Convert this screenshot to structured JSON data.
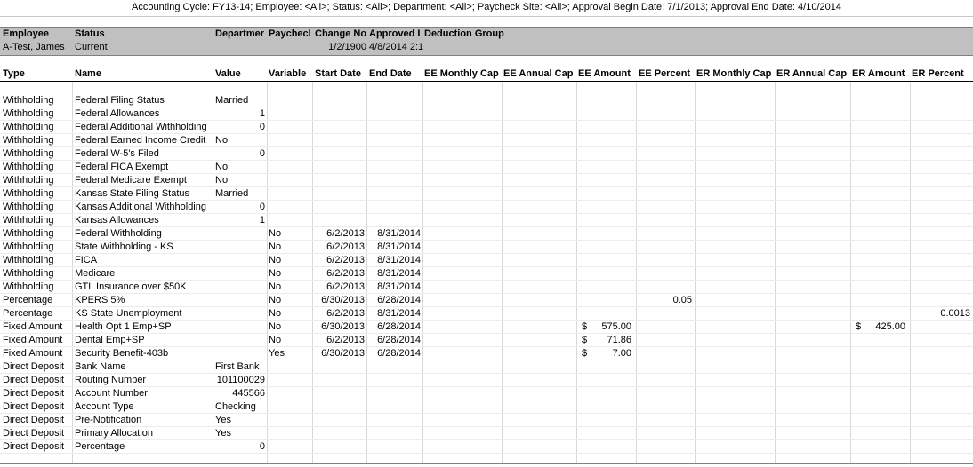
{
  "report": {
    "title": "Accounting Cycle: FY13-14; Employee: <All>; Status: <All>; Department: <All>; Paycheck Site: <All>; Approval Begin Date: 7/1/2013; Approval End Date: 4/10/2014"
  },
  "employee_header": {
    "employee_label": "Employee",
    "status_label": "Status",
    "department_label": "Departmer",
    "paycheck_label": "Paychecl",
    "change_label": "Change No",
    "approved_label": "Approved I",
    "deduction_label": "Deduction Group",
    "employee_name": "A-Test, James",
    "status_value": "Current",
    "change_value": "1/2/1900",
    "approved_value": "4/8/2014 2:1"
  },
  "columns": [
    "Type",
    "Name",
    "Value",
    "Variable",
    "Start Date",
    "End Date",
    "EE Monthly Cap",
    "EE Annual Cap",
    "EE Amount",
    "EE Percent",
    "ER Monthly Cap",
    "ER Annual Cap",
    "ER Amount",
    "ER Percent"
  ],
  "rows": [
    {
      "type": "Withholding",
      "name": "Federal Filing Status",
      "value": "Married",
      "valueNum": false
    },
    {
      "type": "Withholding",
      "name": "Federal Allowances",
      "value": "1",
      "valueNum": true
    },
    {
      "type": "Withholding",
      "name": "Federal Additional Withholding",
      "value": "0",
      "valueNum": true
    },
    {
      "type": "Withholding",
      "name": "Federal Earned Income Credit",
      "value": "No",
      "valueNum": false
    },
    {
      "type": "Withholding",
      "name": "Federal W-5's Filed",
      "value": "0",
      "valueNum": true
    },
    {
      "type": "Withholding",
      "name": "Federal FICA Exempt",
      "value": "No",
      "valueNum": false
    },
    {
      "type": "Withholding",
      "name": "Federal Medicare Exempt",
      "value": "No",
      "valueNum": false
    },
    {
      "type": "Withholding",
      "name": "Kansas State Filing Status",
      "value": "Married",
      "valueNum": false
    },
    {
      "type": "Withholding",
      "name": "Kansas Additional Withholding",
      "value": "0",
      "valueNum": true
    },
    {
      "type": "Withholding",
      "name": "Kansas Allowances",
      "value": "1",
      "valueNum": true
    },
    {
      "type": "Withholding",
      "name": "Federal Withholding",
      "variable": "No",
      "start": "6/2/2013",
      "end": "8/31/2014"
    },
    {
      "type": "Withholding",
      "name": "State Withholding - KS",
      "variable": "No",
      "start": "6/2/2013",
      "end": "8/31/2014"
    },
    {
      "type": "Withholding",
      "name": "FICA",
      "variable": "No",
      "start": "6/2/2013",
      "end": "8/31/2014"
    },
    {
      "type": "Withholding",
      "name": "Medicare",
      "variable": "No",
      "start": "6/2/2013",
      "end": "8/31/2014"
    },
    {
      "type": "Withholding",
      "name": "GTL Insurance over $50K",
      "variable": "No",
      "start": "6/2/2013",
      "end": "8/31/2014"
    },
    {
      "type": "Percentage",
      "name": "KPERS 5%",
      "variable": "No",
      "start": "6/30/2013",
      "end": "6/28/2014",
      "ee_percent": "0.05"
    },
    {
      "type": "Percentage",
      "name": "KS State Unemployment",
      "variable": "No",
      "start": "6/2/2013",
      "end": "8/31/2014",
      "er_percent": "0.0013"
    },
    {
      "type": "Fixed Amount",
      "name": "Health Opt 1 Emp+SP",
      "variable": "No",
      "start": "6/30/2013",
      "end": "6/28/2014",
      "ee_cur": "$",
      "ee_amount": "575.00",
      "er_cur": "$",
      "er_amount": "425.00"
    },
    {
      "type": "Fixed Amount",
      "name": "Dental Emp+SP",
      "variable": "No",
      "start": "6/2/2013",
      "end": "6/28/2014",
      "ee_cur": "$",
      "ee_amount": "71.86"
    },
    {
      "type": "Fixed Amount",
      "name": "Security Benefit-403b",
      "variable": "Yes",
      "start": "6/30/2013",
      "end": "6/28/2014",
      "ee_cur": "$",
      "ee_amount": "7.00"
    },
    {
      "type": "Direct Deposit",
      "name": "Bank Name",
      "value": "First Bank",
      "valueNum": false
    },
    {
      "type": "Direct Deposit",
      "name": "Routing Number",
      "value": "101100029",
      "valueNum": true
    },
    {
      "type": "Direct Deposit",
      "name": "Account Number",
      "value": "445566",
      "valueNum": true
    },
    {
      "type": "Direct Deposit",
      "name": "Account Type",
      "value": "Checking",
      "valueNum": false
    },
    {
      "type": "Direct Deposit",
      "name": "Pre-Notification",
      "value": "Yes",
      "valueNum": false
    },
    {
      "type": "Direct Deposit",
      "name": "Primary Allocation",
      "value": "Yes",
      "valueNum": false
    },
    {
      "type": "Direct Deposit",
      "name": "Percentage",
      "value": "0",
      "valueNum": true
    }
  ]
}
